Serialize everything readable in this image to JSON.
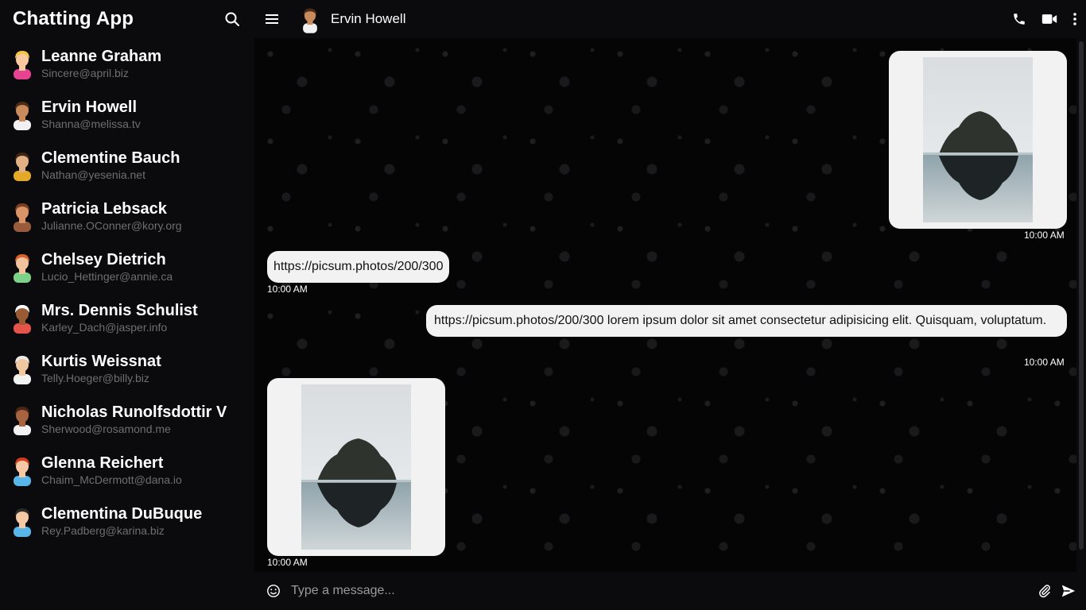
{
  "sidebar": {
    "title": "Chatting App",
    "contacts": [
      {
        "name": "Leanne Graham",
        "email": "Sincere@april.biz",
        "hair": "#f4c542",
        "shirt": "#e84393",
        "skin": "#f9c9a0"
      },
      {
        "name": "Ervin Howell",
        "email": "Shanna@melissa.tv",
        "hair": "#4a2b18",
        "shirt": "#f1f1f1",
        "skin": "#c98a5c"
      },
      {
        "name": "Clementine Bauch",
        "email": "Nathan@yesenia.net",
        "hair": "#3b2516",
        "shirt": "#e5a928",
        "skin": "#e2b085"
      },
      {
        "name": "Patricia Lebsack",
        "email": "Julianne.OConner@kory.org",
        "hair": "#7a3e22",
        "shirt": "#9a5b3c",
        "skin": "#d99568"
      },
      {
        "name": "Chelsey Dietrich",
        "email": "Lucio_Hettinger@annie.ca",
        "hair": "#d9622b",
        "shirt": "#7bd389",
        "skin": "#f2c39c"
      },
      {
        "name": "Mrs. Dennis Schulist",
        "email": "Karley_Dach@jasper.info",
        "hair": "#ffffff",
        "shirt": "#e5534b",
        "skin": "#9a5a34"
      },
      {
        "name": "Kurtis Weissnat",
        "email": "Telly.Hoeger@billy.biz",
        "hair": "#e8e8e8",
        "shirt": "#f2f2f2",
        "skin": "#f1c8a2"
      },
      {
        "name": "Nicholas Runolfsdottir V",
        "email": "Sherwood@rosamond.me",
        "hair": "#4a2515",
        "shirt": "#f1f1f1",
        "skin": "#a86440"
      },
      {
        "name": "Glenna Reichert",
        "email": "Chaim_McDermott@dana.io",
        "hair": "#d23b1f",
        "shirt": "#58b6e8",
        "skin": "#f5c9a4"
      },
      {
        "name": "Clementina DuBuque",
        "email": "Rey.Padberg@karina.biz",
        "hair": "#2a2a2a",
        "shirt": "#58b6e8",
        "skin": "#f5c9a4"
      }
    ]
  },
  "chat": {
    "contact_name": "Ervin Howell",
    "messages": [
      {
        "type": "image",
        "side": "right",
        "time": "10:00 AM"
      },
      {
        "type": "text",
        "side": "left",
        "text": "https://picsum.photos/200/300",
        "time": "10:00 AM"
      },
      {
        "type": "text",
        "side": "right",
        "text": "https://picsum.photos/200/300 lorem ipsum dolor sit amet consectetur adipisicing elit. Quisquam, voluptatum.",
        "time": "10:00 AM"
      },
      {
        "type": "image",
        "side": "left",
        "time": "10:00 AM"
      }
    ]
  },
  "composer": {
    "placeholder": "Type a message..."
  },
  "icons": {
    "search": "search-icon",
    "menu": "menu-icon",
    "call": "phone-icon",
    "video": "video-icon",
    "more": "more-vertical-icon",
    "emoji": "emoji-icon",
    "attach": "paperclip-icon",
    "send": "send-icon"
  },
  "colors": {
    "bubble": "#f2f2f2",
    "background": "#0b0b0d",
    "email_text": "#6e6e73"
  }
}
